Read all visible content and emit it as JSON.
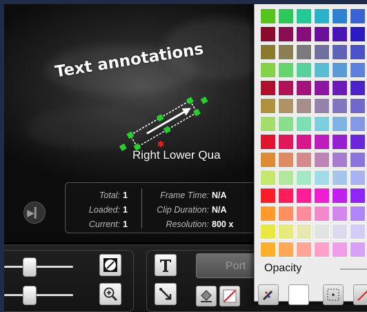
{
  "viewer": {
    "annotation_text": "Text annotations",
    "region_label": "Right Lower Qua",
    "marker_glyph": "✱",
    "play_icon": "▶▎"
  },
  "info": {
    "total_label": "Total:",
    "total_value": "1",
    "loaded_label": "Loaded:",
    "loaded_value": "1",
    "current_label": "Current:",
    "current_value": "1",
    "frame_time_label": "Frame Time:",
    "frame_time_value": "N/A",
    "clip_duration_label": "Clip Duration:",
    "clip_duration_value": "N/A",
    "resolution_label": "Resolution:",
    "resolution_value": "800 x"
  },
  "toolbar": {
    "portrait_label": "Port",
    "slider1_level": 0.35,
    "slider2_level": 0.35
  },
  "color_picker": {
    "opacity_label": "Opacity",
    "swatches": [
      [
        "#55c51c",
        "#2cc95a",
        "#25c995",
        "#2cb1cc",
        "#2e81d1",
        "#3a62d5"
      ],
      [
        "#8a0a2e",
        "#8a0e53",
        "#860d7a",
        "#6c109c",
        "#4a15b4",
        "#2a1cc2"
      ],
      [
        "#8a7a2e",
        "#8a7e55",
        "#7c7a7c",
        "#7070a0",
        "#5f63b7",
        "#4a52c7"
      ],
      [
        "#86d246",
        "#66d46f",
        "#57d29c",
        "#58bdd2",
        "#5a9bd7",
        "#5f7fdc"
      ],
      [
        "#b0102e",
        "#b01256",
        "#a6127c",
        "#8e15a3",
        "#6c1ab9",
        "#4a24c8"
      ],
      [
        "#b0913c",
        "#b09365",
        "#a68f8a",
        "#9583ad",
        "#8376c0",
        "#6f69cc"
      ],
      [
        "#a3de6a",
        "#8adf8c",
        "#7ddfb3",
        "#7ccfdf",
        "#7fb3e3",
        "#8399e6"
      ],
      [
        "#e0142e",
        "#e01759",
        "#d6188a",
        "#bf1cbd",
        "#951fd1",
        "#6a26d8"
      ],
      [
        "#e08a34",
        "#e08a62",
        "#d6898c",
        "#bf84b6",
        "#a77ccf",
        "#8b74db"
      ],
      [
        "#c4e86e",
        "#b2e89b",
        "#a5e8c5",
        "#a2dbe8",
        "#a5c5ec",
        "#a9b3ef"
      ],
      [
        "#ff1e28",
        "#ff1e5a",
        "#ff1e96",
        "#f01ed2",
        "#c21ef0",
        "#8f26f5"
      ],
      [
        "#ff9a2a",
        "#ff8f60",
        "#ff8a99",
        "#f388cc",
        "#d586ee",
        "#b184f7"
      ],
      [
        "#e8e83e",
        "#e8ea7a",
        "#e8e8b0",
        "#e0e4e2",
        "#dcd9f0",
        "#d3cdf6"
      ],
      [
        "#ffb028",
        "#ffa858",
        "#ffa496",
        "#ffa0c9",
        "#f09eea",
        "#d9a0f5"
      ]
    ]
  }
}
